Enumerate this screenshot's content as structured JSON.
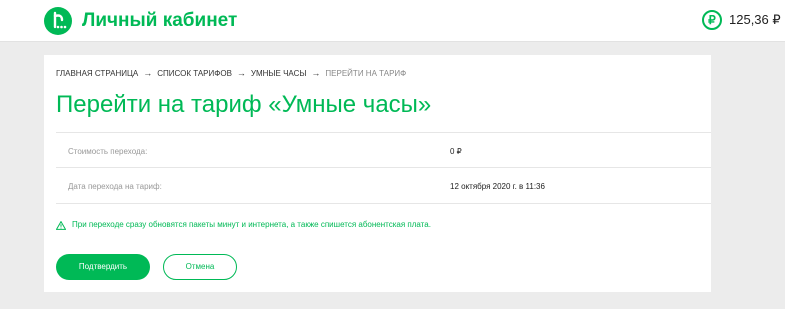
{
  "header": {
    "logo_icon": "megafon-logo-icon",
    "title": "Личный кабинет",
    "balance_icon_glyph": "₽",
    "balance": "125,36 ₽"
  },
  "breadcrumb": {
    "items": [
      "ГЛАВНАЯ СТРАНИЦА",
      "СПИСОК ТАРИФОВ",
      "УМНЫЕ ЧАСЫ",
      "ПЕРЕЙТИ НА ТАРИФ"
    ],
    "separator": "→"
  },
  "page": {
    "title": "Перейти на тариф «Умные часы»"
  },
  "details": [
    {
      "label": "Стоимость перехода:",
      "value": "0 ₽"
    },
    {
      "label": "Дата перехода на тариф:",
      "value": "12 октября 2020 г. в 11:36"
    }
  ],
  "notice": {
    "icon": "warning-triangle-icon",
    "text": "При переходе сразу обновятся пакеты минут и интернета, а также спишется абонентская плата."
  },
  "actions": {
    "confirm_label": "Подтвердить",
    "cancel_label": "Отмена"
  },
  "colors": {
    "accent": "#00b956",
    "background": "#ececec"
  }
}
